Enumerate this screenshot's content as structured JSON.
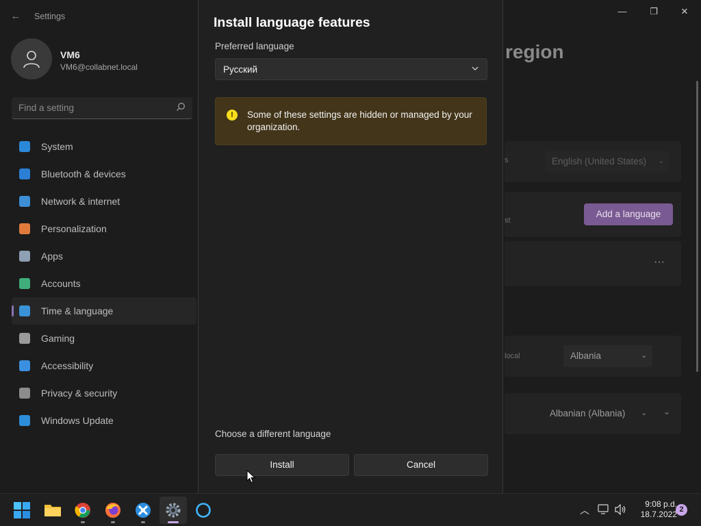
{
  "window": {
    "title": "Settings",
    "back_glyph": "←",
    "minimize_glyph": "—",
    "maximize_glyph": "❐",
    "close_glyph": "✕"
  },
  "profile": {
    "name": "VM6",
    "email": "VM6@collabnet.local"
  },
  "search": {
    "placeholder": "Find a setting"
  },
  "sidebar": {
    "items": [
      {
        "label": "System",
        "icon": "system-icon",
        "color": "#2b88d8"
      },
      {
        "label": "Bluetooth & devices",
        "icon": "bluetooth-icon",
        "color": "#2b7fd4"
      },
      {
        "label": "Network & internet",
        "icon": "wifi-icon",
        "color": "#3d8fd6"
      },
      {
        "label": "Personalization",
        "icon": "brush-icon",
        "color": "#e07b3c"
      },
      {
        "label": "Apps",
        "icon": "apps-icon",
        "color": "#8f9fb4"
      },
      {
        "label": "Accounts",
        "icon": "person-icon",
        "color": "#3fae7a"
      },
      {
        "label": "Time & language",
        "icon": "globe-clock-icon",
        "color": "#3a93d6"
      },
      {
        "label": "Gaming",
        "icon": "gamepad-icon",
        "color": "#9a9a9a"
      },
      {
        "label": "Accessibility",
        "icon": "accessibility-icon",
        "color": "#3b8fe0"
      },
      {
        "label": "Privacy & security",
        "icon": "shield-icon",
        "color": "#8c8c8c"
      },
      {
        "label": "Windows Update",
        "icon": "update-icon",
        "color": "#2d8dd9"
      }
    ],
    "active_index": 6
  },
  "background_page": {
    "title_fragment": "region",
    "windows_display_language": "English (United States)",
    "add_language_label": "Add a language",
    "more_glyph": "···",
    "country_value": "Albania",
    "regional_format_value": "Albanian (Albania)",
    "frag_s": "s",
    "frag_st": "st",
    "frag_local": "local"
  },
  "dialog": {
    "title": "Install language features",
    "preferred_label": "Preferred language",
    "selected_language": "Русский",
    "info_message": "Some of these settings are hidden or managed by your organization.",
    "info_glyph": "!",
    "link_label": "Choose a different language",
    "install_label": "Install",
    "cancel_label": "Cancel"
  },
  "taskbar": {
    "apps": [
      {
        "name": "start",
        "icon": "windows-logo-icon"
      },
      {
        "name": "file-explorer",
        "icon": "folder-icon"
      },
      {
        "name": "chrome",
        "icon": "chrome-icon"
      },
      {
        "name": "firefox",
        "icon": "firefox-icon"
      },
      {
        "name": "app",
        "icon": "star-x-icon"
      },
      {
        "name": "settings",
        "icon": "gear-icon"
      },
      {
        "name": "cortana",
        "icon": "circle-icon"
      }
    ],
    "time": "9:08 p.d.",
    "date": "18.7.2022",
    "notification_count": "2"
  },
  "colors": {
    "accent": "#8a72b0",
    "warning_bg": "#433519",
    "warning_icon": "#f7df1e"
  }
}
